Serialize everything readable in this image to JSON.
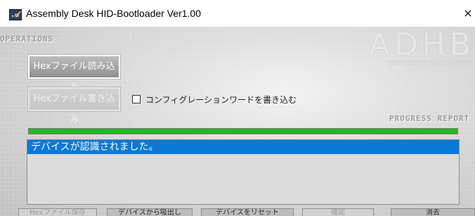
{
  "window": {
    "title": "Assembly Desk HID-Bootloader Ver1.00",
    "close_label": "×",
    "icon_glyph": "𝒜"
  },
  "sections": {
    "operations": "OPERATIONS",
    "progress_report": "PROGRESS REPORT"
  },
  "brand": {
    "logo": "ADHB",
    "subtitle": "AssemblyDesk HID Bootloader"
  },
  "buttons": {
    "read_hex": "Hexファイル読み込み",
    "write_hex": "Hexファイル書き込み"
  },
  "checkbox": {
    "label": "コンフィグレーションワードを書き込む",
    "checked": false
  },
  "progress": {
    "fraction": 1.0,
    "color": "#22b722"
  },
  "log": {
    "items": [
      "デバイスが認識されました。"
    ]
  },
  "bottom": {
    "buttons": [
      "Hexファイル保存",
      "デバイスから吸出し",
      "デバイスをリセット",
      "確認",
      "消去"
    ]
  }
}
